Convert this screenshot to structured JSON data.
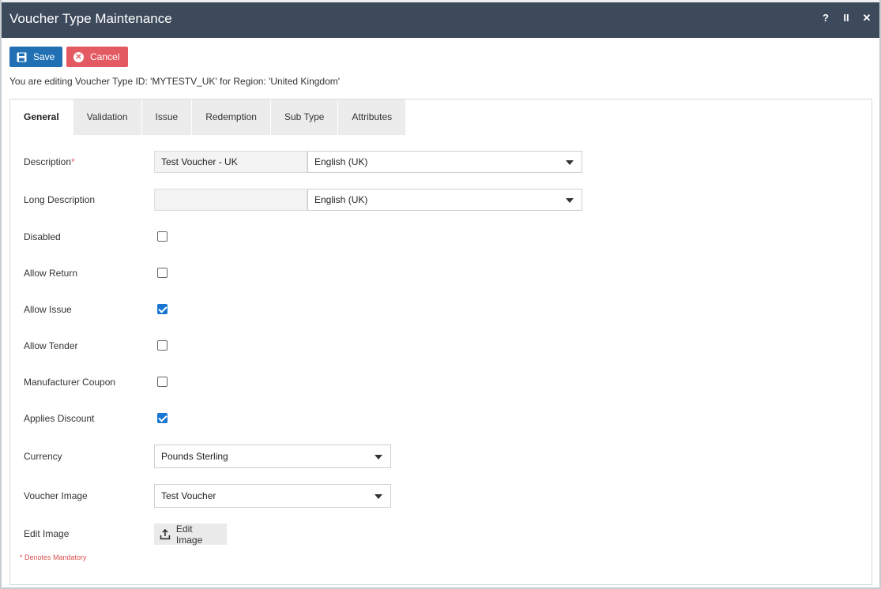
{
  "window": {
    "title": "Voucher Type Maintenance",
    "icons": {
      "help": "?",
      "pause": "II",
      "close": "✕"
    }
  },
  "toolbar": {
    "save_label": "Save",
    "cancel_label": "Cancel"
  },
  "info_text": "You are editing Voucher Type ID: 'MYTESTV_UK' for Region: 'United Kingdom'",
  "tabs": [
    {
      "label": "General",
      "active": true
    },
    {
      "label": "Validation"
    },
    {
      "label": "Issue"
    },
    {
      "label": "Redemption"
    },
    {
      "label": "Sub Type"
    },
    {
      "label": "Attributes"
    }
  ],
  "form": {
    "description": {
      "label": "Description",
      "required_mark": "*",
      "value": "Test Voucher - UK",
      "language": "English (UK)"
    },
    "long_description": {
      "label": "Long Description",
      "value": "",
      "language": "English (UK)"
    },
    "disabled": {
      "label": "Disabled",
      "checked": false
    },
    "allow_return": {
      "label": "Allow Return",
      "checked": false
    },
    "allow_issue": {
      "label": "Allow Issue",
      "checked": true
    },
    "allow_tender": {
      "label": "Allow Tender",
      "checked": false
    },
    "manufacturer_coupon": {
      "label": "Manufacturer Coupon",
      "checked": false
    },
    "applies_discount": {
      "label": "Applies Discount",
      "checked": true
    },
    "currency": {
      "label": "Currency",
      "value": "Pounds Sterling"
    },
    "voucher_image": {
      "label": "Voucher Image",
      "value": "Test Voucher"
    },
    "edit_image": {
      "label": "Edit Image",
      "button_label": "Edit Image"
    }
  },
  "mandatory_note": "* Denotes Mandatory",
  "colors": {
    "titlebar": "#3d4a5c",
    "save": "#2170b4",
    "cancel": "#e35a63",
    "checkbox_checked": "#1976d2"
  }
}
